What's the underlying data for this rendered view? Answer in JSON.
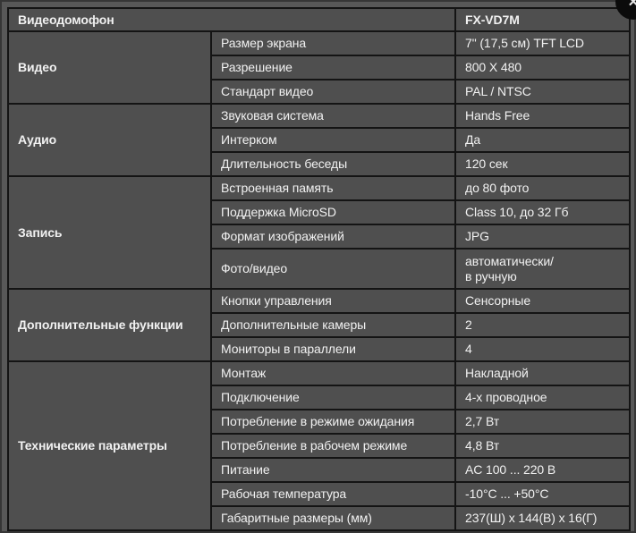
{
  "window": {
    "close_icon": "✕"
  },
  "colors": {
    "accent_orange": "#F3A51F",
    "cell_bg": "#4F4F4F",
    "page_bg": "#585858",
    "border": "#141414",
    "text": "#F1F1F1",
    "close_btn_bg": "#0B0B0B"
  },
  "table": {
    "header": {
      "title": "Видеодомофон",
      "model": "FX-VD7M"
    },
    "sections": [
      {
        "category": "Видео",
        "rows": [
          {
            "param": "Размер экрана",
            "value": "7\" (17,5 см) TFT LCD"
          },
          {
            "param": "Разрешение",
            "value": "800 X 480"
          },
          {
            "param": "Стандарт видео",
            "value": "PAL / NTSC"
          }
        ]
      },
      {
        "category": "Аудио",
        "rows": [
          {
            "param": "Звуковая система",
            "value": "Hands Free"
          },
          {
            "param": "Интерком",
            "value": "Да"
          },
          {
            "param": "Длительность беседы",
            "value": "120 сек"
          }
        ]
      },
      {
        "category": "Запись",
        "rows": [
          {
            "param": "Встроенная память",
            "value": "до 80 фото"
          },
          {
            "param": "Поддержка MicroSD",
            "value": "Class 10, до 32 Гб"
          },
          {
            "param": "Формат изображений",
            "value": "JPG"
          },
          {
            "param": "Фото/видео",
            "value": "автоматически/\nв ручную"
          }
        ]
      },
      {
        "category": "Дополнительные функции",
        "rows": [
          {
            "param": "Кнопки управления",
            "value": "Сенсорные"
          },
          {
            "param": "Дополнительные камеры",
            "value": "2"
          },
          {
            "param": "Мониторы в параллели",
            "value": "4"
          }
        ]
      },
      {
        "category": "Технические параметры",
        "rows": [
          {
            "param": "Монтаж",
            "value": "Накладной"
          },
          {
            "param": "Подключение",
            "value": "4-х проводное"
          },
          {
            "param": "Потребление в режиме ожидания",
            "value": "2,7 Вт"
          },
          {
            "param": "Потребление в рабочем режиме",
            "value": "4,8 Вт"
          },
          {
            "param": "Питание",
            "value": "AC 100 ... 220 В"
          },
          {
            "param": "Рабочая температура",
            "value": "-10°C ... +50°C"
          },
          {
            "param": "Габаритные размеры (мм)",
            "value": "237(Ш) x 144(В) x 16(Г)"
          }
        ]
      }
    ]
  }
}
